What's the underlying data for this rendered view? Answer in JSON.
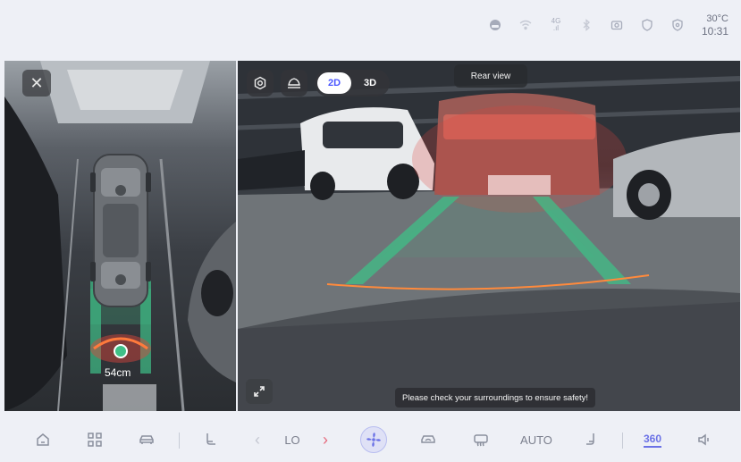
{
  "status": {
    "icons": [
      "vehicle-icon",
      "wifi-icon",
      "signal-icon",
      "bluetooth-icon",
      "camera-icon",
      "shield-icon",
      "security-icon"
    ],
    "signal_label": "4G",
    "temperature": "30°C",
    "time": "10:31"
  },
  "left_view": {
    "close_icon": "close-icon",
    "distance": "54cm"
  },
  "right_view": {
    "modes": [
      "2D",
      "3D"
    ],
    "active_mode": "2D",
    "view_label": "Rear view",
    "notice": "Please check your surroundings to ensure safety!"
  },
  "dock": {
    "home_icon": "home-icon",
    "apps_icon": "apps-icon",
    "car_icon": "car-icon",
    "seat_icon": "seat-icon",
    "temp_value": "LO",
    "fan_icon": "fan-icon",
    "recirculation_icon": "recirculation-icon",
    "defrost_icon": "rear-defrost-icon",
    "auto_label": "AUTO",
    "seat_heat_icon": "seat-heat-icon",
    "view360_label": "360",
    "volume_icon": "volume-icon"
  },
  "colors": {
    "accent": "#4b57ff",
    "guide_green": "#3fbf87",
    "warning_red": "#e0453c",
    "arrow_red": "#e56a7d"
  }
}
